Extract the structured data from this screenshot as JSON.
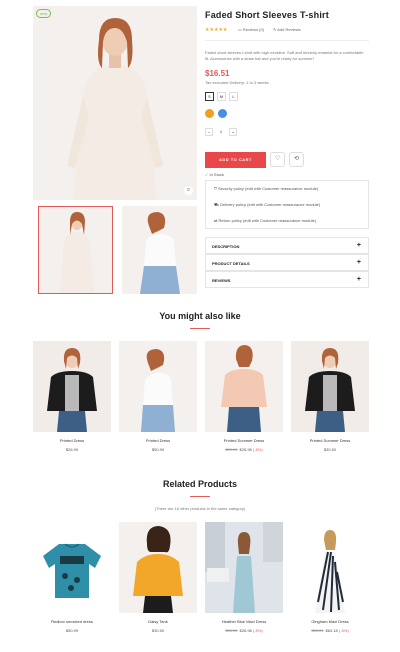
{
  "product": {
    "badge": "new",
    "title": "Faded Short Sleeves T-shirt",
    "stars": "★★★★★",
    "reviews_label": "Reviews (0)",
    "add_review_label": "Add Reviews",
    "description": "Faded short sleeves t-shirt with high neckline. Soft and stretchy material for a comfortable fit. Accessorize with a straw hat and you're ready for summer!",
    "price": "$16.51",
    "tax": "Tax excluded Delivery: 1 to 3 weeks",
    "sizes": [
      "S",
      "M",
      "L"
    ],
    "selected_size": "S",
    "colors": [
      "#f0a01e",
      "#4a8ee3"
    ],
    "quantity": "1",
    "add_to_cart": "ADD TO CART",
    "stock": "In Stock",
    "policies": [
      "Security policy (edit with Customer reassurance module)",
      "Delivery policy (edit with Customer reassurance module)",
      "Return policy (edit with Customer reassurance module)"
    ],
    "accordion": [
      "DESCRIPTION",
      "PRODUCT DETAILS",
      "REVIEWS"
    ]
  },
  "might_like": {
    "title": "You might also like",
    "items": [
      {
        "name": "Printed Dress",
        "price": "$26.99",
        "old": "",
        "disc": ""
      },
      {
        "name": "Printed Dress",
        "price": "$50.99",
        "old": "",
        "disc": ""
      },
      {
        "name": "Printed Summer Dress",
        "price": "$28.98",
        "old": "$30.50",
        "disc": "(-5%)"
      },
      {
        "name": "Printed Summer Dress",
        "price": "$30.50",
        "old": "",
        "disc": ""
      }
    ]
  },
  "related": {
    "title": "Related Products",
    "subtitle": "(There are 16 other products in the same category)",
    "items": [
      {
        "name": "Redbox smocked dress",
        "price": "$50.99",
        "old": "",
        "disc": ""
      },
      {
        "name": "Daisy Tank",
        "price": "$30.50",
        "old": "",
        "disc": ""
      },
      {
        "name": "Heather Blue Maxi Dress",
        "price": "$28.98",
        "old": "$30.50",
        "disc": "(-5%)"
      },
      {
        "name": "Gingham Maxi Dress",
        "price": "$63.18",
        "old": "$88.81",
        "disc": "(-5%)"
      }
    ]
  }
}
